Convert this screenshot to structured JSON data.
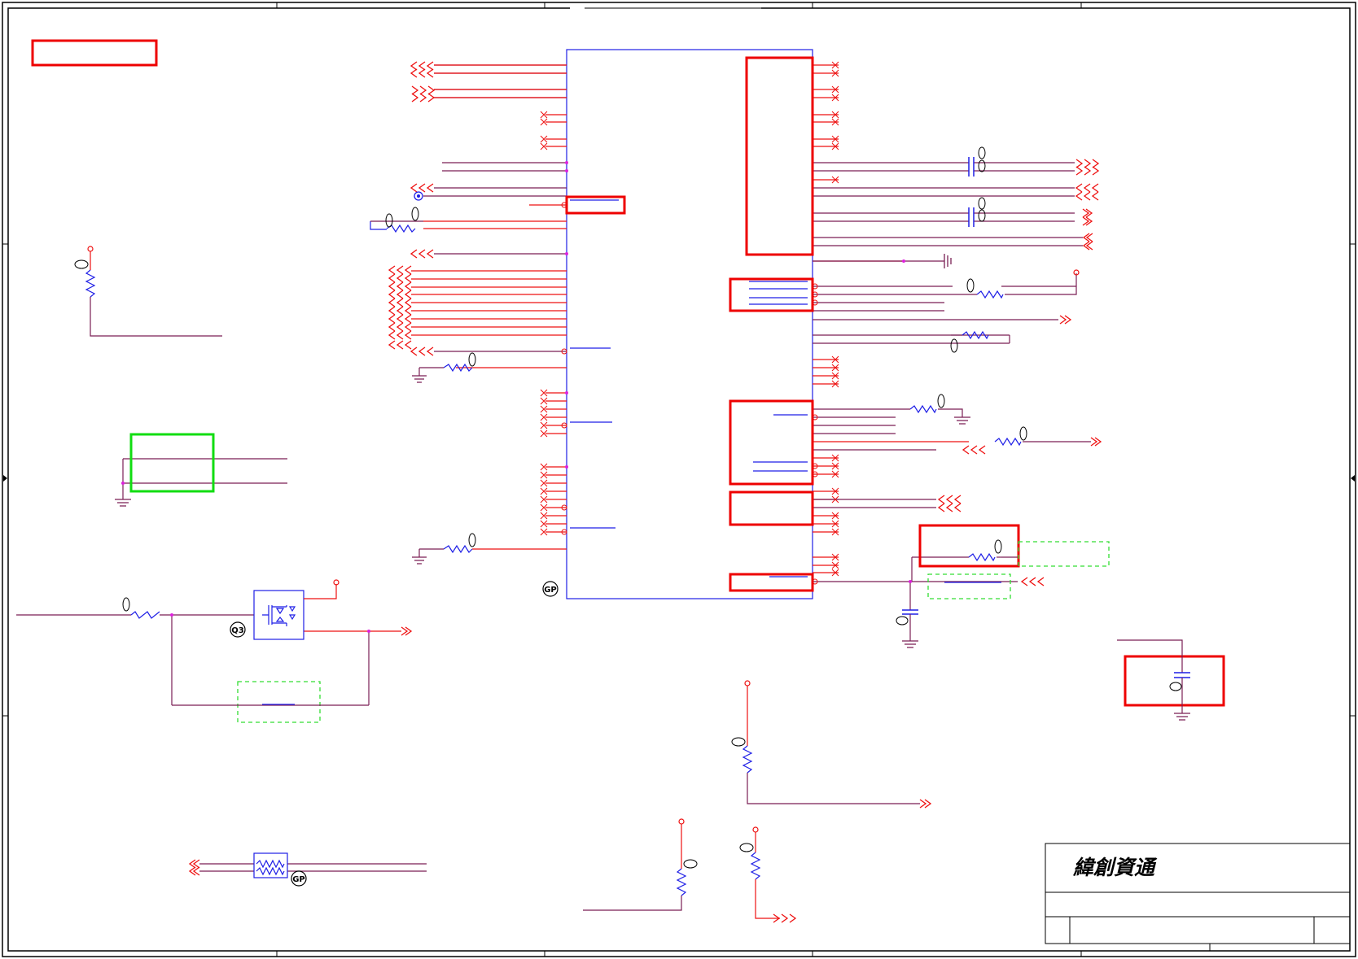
{
  "title_block": {
    "company_logo": "緯創資通"
  },
  "tags": {
    "main_ic": "GP",
    "transistor": "Q3",
    "fuse": "GP"
  },
  "colors": {
    "wire": "#ee1111",
    "net": "#7a1f55",
    "part": "#1e1ee6",
    "junction": "#dd22dd",
    "frame": "#000000",
    "highlight_red": "#ee0000",
    "highlight_green": "#11dd11",
    "highlight_dashed": "#33dd33"
  }
}
